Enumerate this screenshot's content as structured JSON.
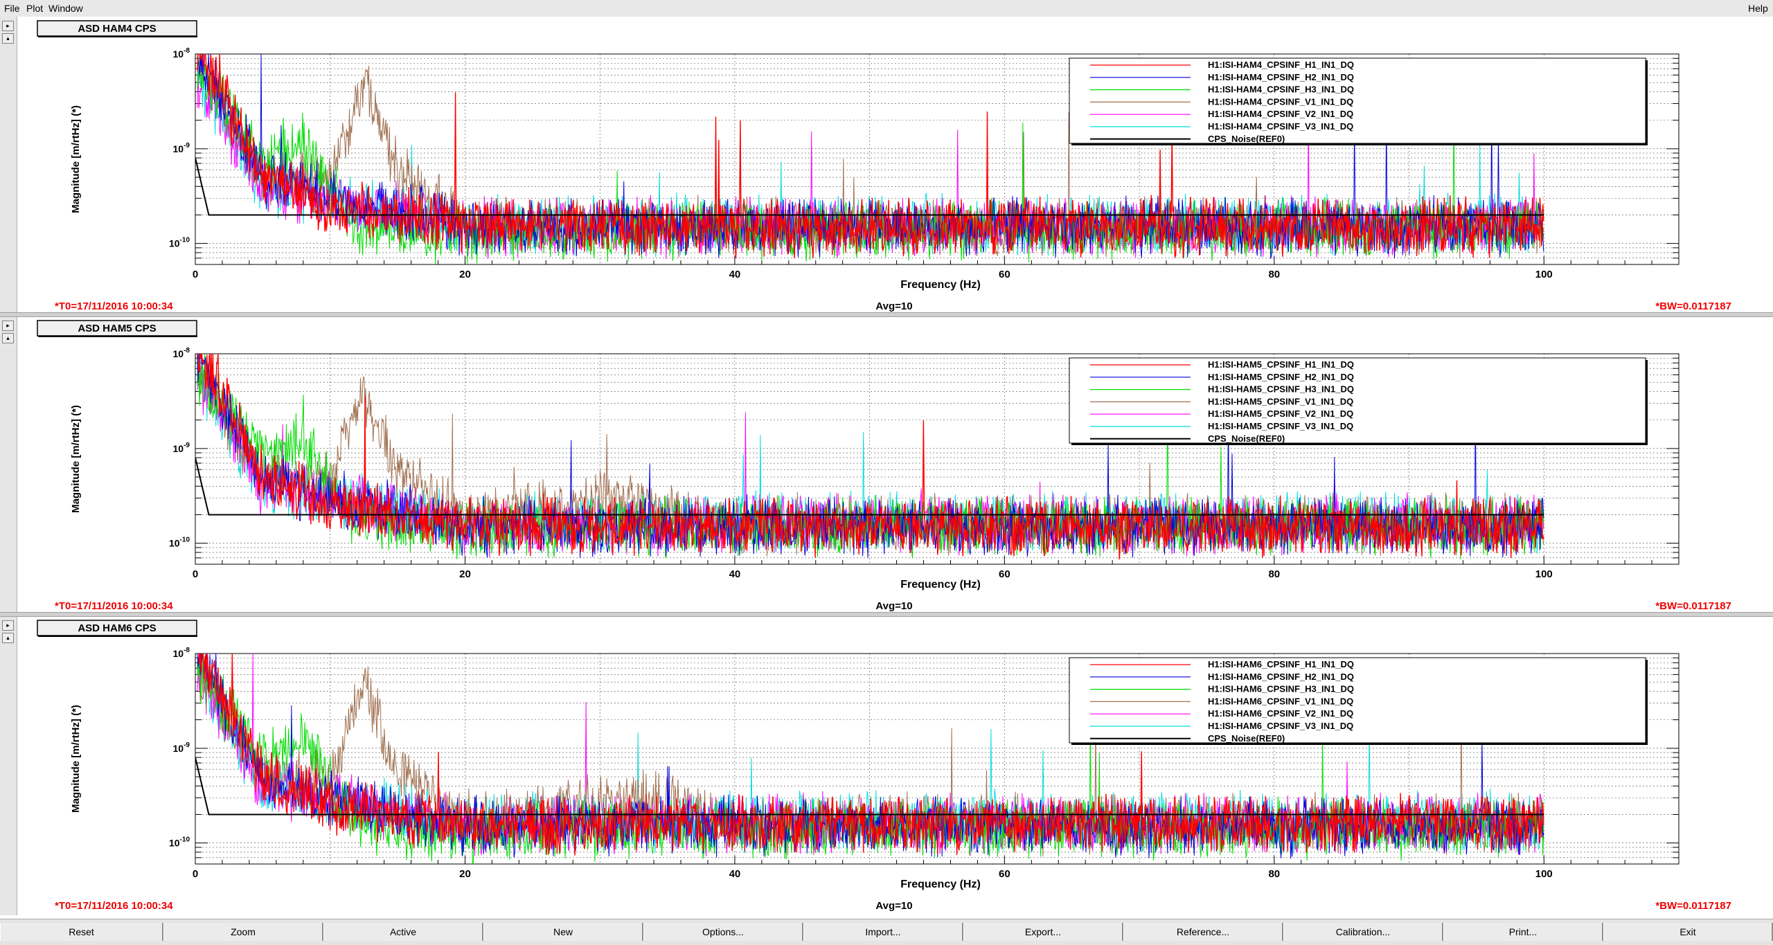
{
  "menu": {
    "file": "File",
    "plot": "Plot",
    "window": "Window",
    "help": "Help"
  },
  "colors": {
    "background": "#ffffff",
    "series": [
      "#ff0000",
      "#0000dd",
      "#00dd00",
      "#a07050",
      "#ff00ff",
      "#00dddd",
      "#000000"
    ],
    "info_red": "#ee0000"
  },
  "panels": [
    {
      "title": "ASD HAM4 CPS",
      "t0": "*T0=17/11/2016 10:00:34",
      "avg": "Avg=10",
      "bw": "*BW=0.0117187",
      "xlabel": "Frequency (Hz)",
      "ylabel": "Magnitude [m/rtHz] (*)",
      "legend": [
        "H1:ISI-HAM4_CPSINF_H1_IN1_DQ",
        "H1:ISI-HAM4_CPSINF_H2_IN1_DQ",
        "H1:ISI-HAM4_CPSINF_H3_IN1_DQ",
        "H1:ISI-HAM4_CPSINF_V1_IN1_DQ",
        "H1:ISI-HAM4_CPSINF_V2_IN1_DQ",
        "H1:ISI-HAM4_CPSINF_V3_IN1_DQ",
        "CPS_Noise(REF0)"
      ],
      "seed": 11
    },
    {
      "title": "ASD HAM5 CPS",
      "t0": "*T0=17/11/2016 10:00:34",
      "avg": "Avg=10",
      "bw": "*BW=0.0117187",
      "xlabel": "Frequency (Hz)",
      "ylabel": "Magnitude [m/rtHz] (*)",
      "legend": [
        "H1:ISI-HAM5_CPSINF_H1_IN1_DQ",
        "H1:ISI-HAM5_CPSINF_H2_IN1_DQ",
        "H1:ISI-HAM5_CPSINF_H3_IN1_DQ",
        "H1:ISI-HAM5_CPSINF_V1_IN1_DQ",
        "H1:ISI-HAM5_CPSINF_V2_IN1_DQ",
        "H1:ISI-HAM5_CPSINF_V3_IN1_DQ",
        "CPS_Noise(REF0)"
      ],
      "seed": 23
    },
    {
      "title": "ASD HAM6 CPS",
      "t0": "*T0=17/11/2016 10:00:34",
      "avg": "Avg=10",
      "bw": "*BW=0.0117187",
      "xlabel": "Frequency (Hz)",
      "ylabel": "Magnitude [m/rtHz] (*)",
      "legend": [
        "H1:ISI-HAM6_CPSINF_H1_IN1_DQ",
        "H1:ISI-HAM6_CPSINF_H2_IN1_DQ",
        "H1:ISI-HAM6_CPSINF_H3_IN1_DQ",
        "H1:ISI-HAM6_CPSINF_V1_IN1_DQ",
        "H1:ISI-HAM6_CPSINF_V2_IN1_DQ",
        "H1:ISI-HAM6_CPSINF_V3_IN1_DQ",
        "CPS_Noise(REF0)"
      ],
      "seed": 37
    }
  ],
  "chart_data": [
    {
      "type": "line",
      "title": "ASD HAM4 CPS",
      "xlabel": "Frequency (Hz)",
      "ylabel": "Magnitude [m/rtHz] (*)",
      "xlim": [
        0,
        110
      ],
      "ylim": [
        6e-11,
        1e-08
      ],
      "yscale": "log",
      "xticks": [
        0,
        20,
        40,
        60,
        80,
        100
      ],
      "ytick_labels": [
        "10^-10",
        "10^-9",
        "10^-8"
      ],
      "grid": true,
      "legend_position": "top-right",
      "series": [
        {
          "name": "H1:ISI-HAM4_CPSINF_H1_IN1_DQ",
          "x": [
            0.5,
            5,
            10,
            12.5,
            20,
            40,
            60,
            80,
            100
          ],
          "values": [
            1e-08,
            5e-10,
            2.5e-10,
            2.2e-10,
            1.5e-10,
            1.5e-10,
            1.5e-10,
            1.5e-10,
            1.5e-10
          ]
        },
        {
          "name": "H1:ISI-HAM4_CPSINF_H2_IN1_DQ",
          "x": [
            0.5,
            5,
            10,
            20,
            40,
            60,
            80,
            100
          ],
          "values": [
            8e-09,
            5e-10,
            3e-10,
            1.5e-10,
            1.5e-10,
            1.5e-10,
            1.5e-10,
            1.5e-10
          ]
        },
        {
          "name": "H1:ISI-HAM4_CPSINF_H3_IN1_DQ",
          "x": [
            0.5,
            5,
            8,
            10,
            12,
            20,
            40,
            60,
            80,
            100
          ],
          "values": [
            6e-09,
            8e-10,
            1.2e-09,
            4e-10,
            1.5e-10,
            1.2e-10,
            1.4e-10,
            1.4e-10,
            1.4e-10,
            1.4e-10
          ]
        },
        {
          "name": "H1:ISI-HAM4_CPSINF_V1_IN1_DQ",
          "x": [
            0.5,
            5,
            10,
            12.5,
            15,
            20,
            40,
            60,
            80,
            100
          ],
          "values": [
            6e-09,
            5e-10,
            5e-10,
            5e-09,
            6e-10,
            1.6e-10,
            1.5e-10,
            1.5e-10,
            1.5e-10,
            1.5e-10
          ]
        },
        {
          "name": "H1:ISI-HAM4_CPSINF_V2_IN1_DQ",
          "x": [
            0.5,
            5,
            10,
            20,
            40,
            60,
            80,
            100
          ],
          "values": [
            5e-09,
            4e-10,
            3e-10,
            1.5e-10,
            1.5e-10,
            1.5e-10,
            1.5e-10,
            1.5e-10
          ]
        },
        {
          "name": "H1:ISI-HAM4_CPSINF_V3_IN1_DQ",
          "x": [
            0.5,
            5,
            10,
            20,
            40,
            60,
            80,
            100
          ],
          "values": [
            5e-09,
            4e-10,
            3e-10,
            1.5e-10,
            1.6e-10,
            1.6e-10,
            1.6e-10,
            1.6e-10
          ]
        },
        {
          "name": "CPS_Noise(REF0)",
          "x": [
            0,
            1,
            20,
            100
          ],
          "values": [
            8e-10,
            2e-10,
            2e-10,
            2e-10
          ]
        }
      ]
    },
    {
      "type": "line",
      "title": "ASD HAM5 CPS",
      "xlabel": "Frequency (Hz)",
      "ylabel": "Magnitude [m/rtHz] (*)",
      "xlim": [
        0,
        110
      ],
      "ylim": [
        6e-11,
        1e-08
      ],
      "yscale": "log",
      "xticks": [
        0,
        20,
        40,
        60,
        80,
        100
      ],
      "ytick_labels": [
        "10^-10",
        "10^-9",
        "10^-8"
      ],
      "grid": true,
      "legend_position": "top-right",
      "series": [
        {
          "name": "H1:ISI-HAM5_CPSINF_H1_IN1_DQ",
          "x": [
            0.5,
            5,
            10,
            20,
            40,
            60,
            80,
            100
          ],
          "values": [
            1e-08,
            5e-10,
            2.5e-10,
            1.5e-10,
            1.5e-10,
            1.5e-10,
            1.5e-10,
            1.5e-10
          ]
        },
        {
          "name": "H1:ISI-HAM5_CPSINF_H2_IN1_DQ",
          "x": [
            0.5,
            5,
            10,
            20,
            40,
            60,
            80,
            100
          ],
          "values": [
            8e-09,
            5e-10,
            3e-10,
            1.5e-10,
            1.5e-10,
            1.5e-10,
            1.5e-10,
            1.5e-10
          ]
        },
        {
          "name": "H1:ISI-HAM5_CPSINF_H3_IN1_DQ",
          "x": [
            0.5,
            5,
            8,
            12,
            20,
            40,
            60,
            80,
            100
          ],
          "values": [
            6e-09,
            9e-10,
            1.2e-09,
            1.6e-10,
            1.4e-10,
            1.5e-10,
            1.5e-10,
            1.5e-10,
            1.5e-10
          ]
        },
        {
          "name": "H1:ISI-HAM5_CPSINF_V1_IN1_DQ",
          "x": [
            0.5,
            5,
            10,
            12.5,
            15,
            20,
            30,
            40,
            60,
            80,
            100
          ],
          "values": [
            6e-09,
            5e-10,
            5e-10,
            4e-09,
            6e-10,
            1.8e-10,
            3e-10,
            1.6e-10,
            1.6e-10,
            1.6e-10,
            1.6e-10
          ]
        },
        {
          "name": "H1:ISI-HAM5_CPSINF_V2_IN1_DQ",
          "x": [
            0.5,
            5,
            10,
            20,
            40,
            60,
            80,
            100
          ],
          "values": [
            5e-09,
            4e-10,
            3e-10,
            1.5e-10,
            1.6e-10,
            1.6e-10,
            1.6e-10,
            1.6e-10
          ]
        },
        {
          "name": "H1:ISI-HAM5_CPSINF_V3_IN1_DQ",
          "x": [
            0.5,
            5,
            10,
            20,
            40,
            60,
            80,
            100
          ],
          "values": [
            5e-09,
            4e-10,
            3e-10,
            1.6e-10,
            1.7e-10,
            1.7e-10,
            1.7e-10,
            1.7e-10
          ]
        },
        {
          "name": "CPS_Noise(REF0)",
          "x": [
            0,
            1,
            20,
            100
          ],
          "values": [
            8e-10,
            2e-10,
            2e-10,
            2e-10
          ]
        }
      ]
    },
    {
      "type": "line",
      "title": "ASD HAM6 CPS",
      "xlabel": "Frequency (Hz)",
      "ylabel": "Magnitude [m/rtHz] (*)",
      "xlim": [
        0,
        110
      ],
      "ylim": [
        6e-11,
        1e-08
      ],
      "yscale": "log",
      "xticks": [
        0,
        20,
        40,
        60,
        80,
        100
      ],
      "ytick_labels": [
        "10^-10",
        "10^-9",
        "10^-8"
      ],
      "grid": true,
      "legend_position": "top-right",
      "series": [
        {
          "name": "H1:ISI-HAM6_CPSINF_H1_IN1_DQ",
          "x": [
            0.5,
            5,
            10,
            20,
            40,
            60,
            80,
            100
          ],
          "values": [
            1e-08,
            5e-10,
            2.5e-10,
            1.5e-10,
            1.6e-10,
            1.6e-10,
            1.6e-10,
            1.6e-10
          ]
        },
        {
          "name": "H1:ISI-HAM6_CPSINF_H2_IN1_DQ",
          "x": [
            0.5,
            5,
            10,
            20,
            40,
            60,
            80,
            100
          ],
          "values": [
            8e-09,
            5e-10,
            3e-10,
            1.5e-10,
            1.5e-10,
            1.5e-10,
            1.5e-10,
            1.5e-10
          ]
        },
        {
          "name": "H1:ISI-HAM6_CPSINF_H3_IN1_DQ",
          "x": [
            0.5,
            5,
            8,
            12,
            20,
            40,
            60,
            80,
            100
          ],
          "values": [
            6e-09,
            9e-10,
            1.3e-09,
            1.5e-10,
            1.2e-10,
            1.4e-10,
            1.4e-10,
            1.4e-10,
            1.4e-10
          ]
        },
        {
          "name": "H1:ISI-HAM6_CPSINF_V1_IN1_DQ",
          "x": [
            0.5,
            5,
            10,
            12.5,
            15,
            20,
            34,
            40,
            60,
            80,
            100
          ],
          "values": [
            6e-09,
            5e-10,
            5e-10,
            5e-09,
            6e-10,
            1.7e-10,
            3e-10,
            1.6e-10,
            1.6e-10,
            1.6e-10,
            1.6e-10
          ]
        },
        {
          "name": "H1:ISI-HAM6_CPSINF_V2_IN1_DQ",
          "x": [
            0.5,
            5,
            10,
            20,
            40,
            60,
            80,
            100
          ],
          "values": [
            5e-09,
            4e-10,
            3e-10,
            1.5e-10,
            1.6e-10,
            1.6e-10,
            1.6e-10,
            1.6e-10
          ]
        },
        {
          "name": "H1:ISI-HAM6_CPSINF_V3_IN1_DQ",
          "x": [
            0.5,
            5,
            10,
            20,
            40,
            60,
            80,
            100
          ],
          "values": [
            5e-09,
            4e-10,
            3e-10,
            1.6e-10,
            1.7e-10,
            1.7e-10,
            1.7e-10,
            1.7e-10
          ]
        },
        {
          "name": "CPS_Noise(REF0)",
          "x": [
            0,
            1,
            20,
            100
          ],
          "values": [
            8e-10,
            2e-10,
            2e-10,
            2e-10
          ]
        }
      ]
    }
  ],
  "buttons": [
    "Reset",
    "Zoom",
    "Active",
    "New",
    "Options...",
    "Import...",
    "Export...",
    "Reference...",
    "Calibration...",
    "Print...",
    "Exit"
  ]
}
